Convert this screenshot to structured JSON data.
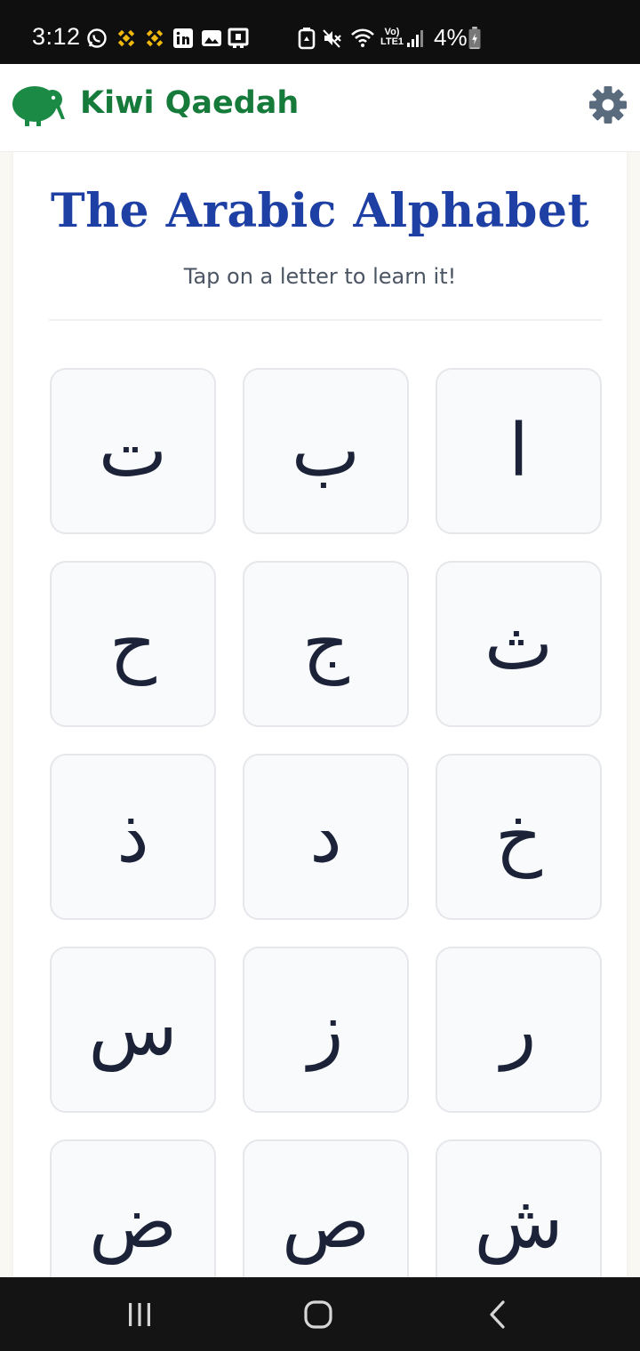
{
  "status_bar": {
    "time": "3:12",
    "battery_percent": "4%",
    "network_label": "Vo) LTE1",
    "battery_level": 0.04,
    "icons": [
      "whatsapp-icon",
      "binance-icon",
      "binance-icon",
      "linkedin-icon",
      "gallery-icon",
      "tv-icon",
      "recycle-icon",
      "mute-icon",
      "wifi-icon",
      "lte-icon",
      "signal-icon",
      "battery-icon"
    ]
  },
  "header": {
    "app_name": "Kiwi Qaedah",
    "logo_icon": "kiwi-bird-icon",
    "settings_icon": "gear-icon"
  },
  "main": {
    "title": "The Arabic Alphabet",
    "subtitle": "Tap on a letter to learn it!",
    "letters": [
      "ا",
      "ب",
      "ت",
      "ث",
      "ج",
      "ح",
      "خ",
      "د",
      "ذ",
      "ر",
      "ز",
      "س",
      "ش",
      "ص",
      "ض"
    ]
  },
  "nav_bar": {
    "icons": [
      "recent-apps-icon",
      "home-icon",
      "back-icon"
    ]
  },
  "colors": {
    "brand_green": "#157a3a",
    "title_blue": "#1e3fa3",
    "settings_gray": "#5a6b7e",
    "tile_background": "#f8fafc",
    "tile_border": "#e5e7eb",
    "letter_color": "#1c2338"
  }
}
